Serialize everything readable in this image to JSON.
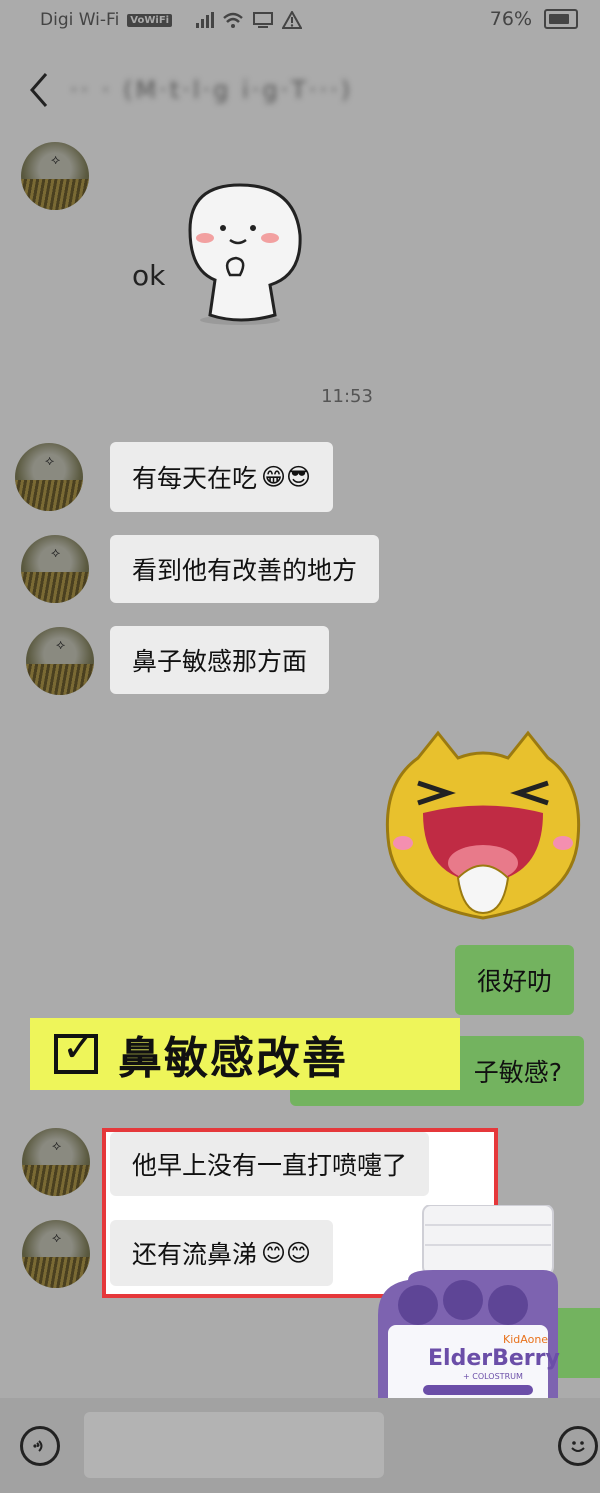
{
  "status": {
    "carrier": "Digi Wi-Fi",
    "vowifi": "VoWiFi",
    "battery": "76%"
  },
  "header": {
    "back_icon": "chevron-left-icon",
    "title": "·· · (M·t·l·g i·g·T···)"
  },
  "chat": {
    "timestamp": "11:53",
    "sticker_ok_text": "ok",
    "messages": [
      {
        "text": "有每天在吃",
        "emoji": "😁😎"
      },
      {
        "text": "看到他有改善的地方",
        "emoji": ""
      },
      {
        "text": "鼻子敏感那方面",
        "emoji": ""
      },
      {
        "text": "很好叻",
        "emoji": ""
      },
      {
        "text": "子敏感?",
        "emoji": ""
      },
      {
        "text": "他早上没有一直打喷嚏了",
        "emoji": ""
      },
      {
        "text": "还有流鼻涕",
        "emoji": "😊😊"
      }
    ]
  },
  "banner": {
    "check": "✓",
    "text": "鼻敏感改善"
  },
  "product": {
    "brand": "KidAone",
    "name": "ElderBerry",
    "sub": "+ COLOSTRUM"
  },
  "colors": {
    "mine_bubble": "#73b35f",
    "their_bubble": "#ececec",
    "highlight_border": "#e5383b",
    "banner_bg": "#eef55a"
  }
}
